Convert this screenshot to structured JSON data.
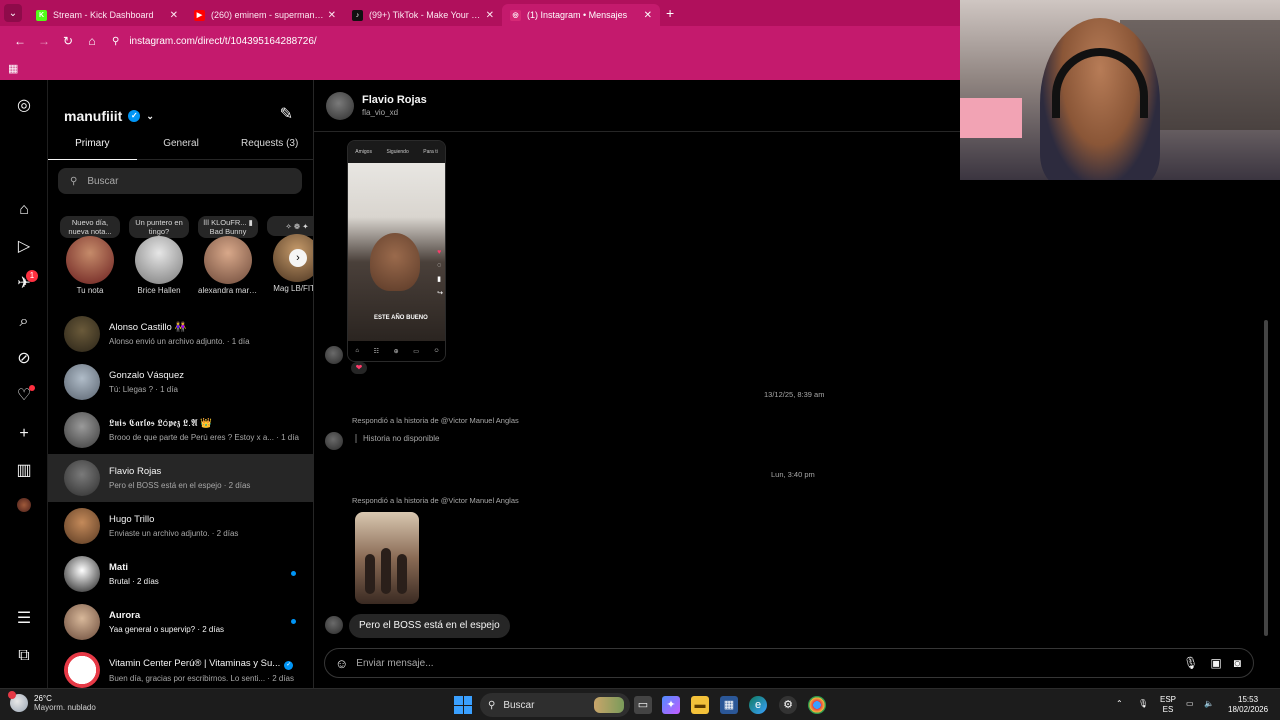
{
  "browser": {
    "tabs": [
      {
        "label": "Stream - Kick Dashboard",
        "icon": "kick-icon",
        "color": "#53fc18",
        "glyph": "K",
        "active": false
      },
      {
        "label": "(260) eminem - superman feat.",
        "icon": "youtube-icon",
        "color": "#ff0000",
        "glyph": "▶",
        "active": false
      },
      {
        "label": "(99+) TikTok - Make Your Day",
        "icon": "tiktok-icon",
        "color": "#111111",
        "glyph": "♪",
        "active": false
      },
      {
        "label": "(1) Instagram • Mensajes",
        "icon": "instagram-icon",
        "color": "#d62976",
        "glyph": "◎",
        "active": true
      }
    ],
    "url": "instagram.com/direct/t/104395164288726/"
  },
  "inbox": {
    "username": "manufiiit",
    "tabs": [
      {
        "label": "Primary",
        "active": true
      },
      {
        "label": "General",
        "active": false
      },
      {
        "label": "Requests (3)",
        "active": false
      }
    ],
    "search_placeholder": "Buscar",
    "notes": [
      {
        "bubble": "Nuevo día, nueva nota...",
        "name": "Tu nota",
        "grad": "radial-gradient(circle at 50% 35%,#c58b6a,#6b1f1f)"
      },
      {
        "bubble": "Un puntero en tingo?",
        "name": "Brice Hallen",
        "grad": "radial-gradient(circle at 50% 35%,#e6e6e6,#7a7a7a)"
      },
      {
        "bubble": "ǀǀǀ KLOuFR... ▮ Bad Bunny",
        "name": "alexandra marti...",
        "grad": "radial-gradient(circle at 50% 35%,#d8a88a,#6e4a3a)"
      },
      {
        "bubble": "✧ ❁ ✦",
        "name": "Mag LB/FITN",
        "grad": "radial-gradient(circle at 50% 35%,#c59a6a,#4a3320)"
      }
    ],
    "threads": [
      {
        "name": "Alonso Castillo 👭",
        "preview": "Alonso envió un archivo adjunto. · 1 día",
        "unread": false,
        "selected": false,
        "verified": false,
        "grad": "radial-gradient(circle at 50% 40%,#6a5a3a,#2a2418)"
      },
      {
        "name": "Gonzalo Vásquez",
        "preview": "Tú: Llegas ? · 1 día",
        "unread": false,
        "selected": false,
        "verified": false,
        "grad": "radial-gradient(circle at 50% 40%,#b0bcc8,#5a6470)"
      },
      {
        "name": "𝕷𝖚𝖎𝖘 𝕮𝖆𝖗𝖑𝖔𝖘 𝕷ó𝖕𝖊𝖟 𝕷.𝕬 👑",
        "preview": "Brooo de que parte de Perú eres ? Estoy x a... · 1 día",
        "unread": false,
        "selected": false,
        "verified": false,
        "grad": "radial-gradient(circle at 50% 40%,#9a9a9a,#3a3a3a)"
      },
      {
        "name": "Flavio Rojas",
        "preview": "Pero el BOSS está en el espejo · 2 días",
        "unread": false,
        "selected": true,
        "verified": false,
        "grad": "radial-gradient(circle at 50% 40%,#7a7a7a,#2e2e2e)"
      },
      {
        "name": "Hugo Trillo",
        "preview": "Enviaste un archivo adjunto. · 2 días",
        "unread": false,
        "selected": false,
        "verified": false,
        "grad": "radial-gradient(circle at 50% 40%,#c48a5a,#5a3a22)"
      },
      {
        "name": "Mati",
        "preview": "Brutal · 2 días",
        "unread": true,
        "selected": false,
        "verified": false,
        "grad": "radial-gradient(circle at 50% 40%,#ffffff,#1a1a1a)"
      },
      {
        "name": "Aurora",
        "preview": "Yaa general o supervip? · 2 días",
        "unread": true,
        "selected": false,
        "verified": false,
        "grad": "radial-gradient(circle at 50% 40%,#d8b89a,#6a4a3a)"
      },
      {
        "name": "Vitamin Center Perú® | Vitaminas y Su...",
        "preview": "Buen día, gracias por escribirnos. Lo senti... · 2 días",
        "unread": false,
        "selected": false,
        "verified": true,
        "grad": "radial-gradient(circle at 50% 50%,#ffffff 55%,#e63946 56%)"
      }
    ]
  },
  "chat": {
    "name": "Flavio Rojas",
    "username": "fla_vio_xd",
    "reel": {
      "top_left": "Amigos",
      "top_mid": "Siguiendo",
      "top_right": "Para ti",
      "caption": "ESTE AÑO BUENO"
    },
    "reaction": "❤",
    "timestamp1": "13/12/25, 8:39 am",
    "reply1": "Respondió a la historia de @Victor Manuel Anglas",
    "unavailable": "Historia no disponible",
    "timestamp2": "Lun, 3:40 pm",
    "reply2": "Respondió a la historia de @Victor Manuel Anglas",
    "message": "Pero el BOSS está en el espejo",
    "composer_placeholder": "Enviar mensaje..."
  },
  "taskbar": {
    "temp": "26°C",
    "weather": "Mayorm. nublado",
    "search_label": "Buscar",
    "lang1": "ESP",
    "lang2": "ES",
    "time": "15:53",
    "date": "18/02/2026"
  }
}
